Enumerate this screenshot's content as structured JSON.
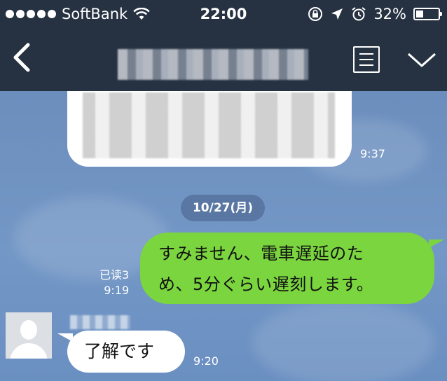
{
  "status_bar": {
    "carrier": "SoftBank",
    "time": "22:00",
    "battery": "32%",
    "battery_level": 0.32
  },
  "chat": {
    "previous_message": {
      "time": "9:37"
    },
    "date_separator": "10/27(月)",
    "sent_message": {
      "line1": "すみません、電車遅延のた",
      "line2": "め、5分ぐらい遅刻します。",
      "read_label": "已读3",
      "time": "9:19"
    },
    "received_message": {
      "text": "了解です",
      "time": "9:20"
    }
  },
  "colors": {
    "top_bar": "#263242",
    "sent_bubble": "#7bd53f",
    "chat_background": "#6d8fbe"
  }
}
